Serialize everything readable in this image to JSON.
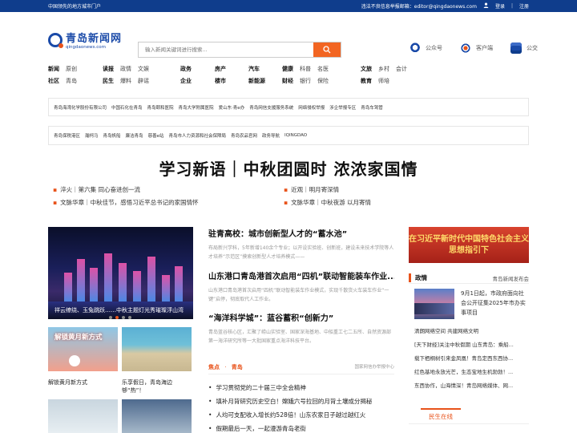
{
  "topbar": {
    "slogan": "中国领先的地方城市门户",
    "report_text": "违法不良信息举报邮箱：editor@qingdaonews.com",
    "login": "登录",
    "register": "注册"
  },
  "header": {
    "logo_cn": "青岛新闻网",
    "logo_en": "qingdaonews.com",
    "search_placeholder": "输入新闻关键词进行搜索...",
    "links": [
      {
        "label": "公众号",
        "icon": "wechat-icon"
      },
      {
        "label": "客户端",
        "icon": "app-icon"
      },
      {
        "label": "公交",
        "icon": "bus-icon"
      }
    ]
  },
  "nav": {
    "groups": [
      {
        "items": [
          "新闻",
          "原创",
          "社区",
          "青岛"
        ],
        "bold": [
          0,
          2
        ]
      },
      {
        "items": [
          "读报",
          "民生",
          "政情",
          "爆料",
          "文娱",
          "辟谣"
        ],
        "bold": [
          0,
          1
        ]
      },
      {
        "items": [
          "政务",
          "企业"
        ],
        "bold": [
          0,
          1
        ]
      },
      {
        "items": [
          "房产",
          "楼市"
        ],
        "bold": [
          0,
          1
        ]
      },
      {
        "items": [
          "汽车",
          "新能源"
        ],
        "bold": [
          0,
          1
        ]
      },
      {
        "items": [
          "健康",
          "财经",
          "科普",
          "银行",
          "名医",
          "保险"
        ],
        "bold": [
          0,
          1
        ]
      },
      {
        "items": [
          "文旅",
          "教育",
          "乡村",
          "师培",
          "会计"
        ],
        "bold": [
          0,
          1
        ]
      }
    ]
  },
  "linkbox1": [
    "青岛海湾化学股份有限公司",
    "中国石化在青岛",
    "青岛颐和医院",
    "青岛大学附属医院",
    "爱山东·青e办",
    "青岛网信支援服务系统",
    "网络侵权举报",
    "涉企举报专区",
    "青岛车驾管"
  ],
  "linkbox2": [
    "青岛保税港区",
    "瀚柯马",
    "青岛帆船",
    "廉洁青岛",
    "慈善e站",
    "青岛市人力资源和社会保障局",
    "青岛农品官网",
    "政务导航",
    "IQINGDAO"
  ],
  "headline": "学习新语｜中秋团圆时 浓浓家国情",
  "sublinks": [
    "淬火｜第六集 同心奋进创一流",
    "近观｜明月寄深情",
    "文脉华章｜中秋佳节，感悟习近平总书记的家国情怀",
    "文脉华章｜中秋夜游 以月寄情"
  ],
  "slider": {
    "caption": "祥云缭绕、玉兔跳跃……中秋主题灯光秀璀璨浮山湾"
  },
  "thumbs": [
    {
      "caption": "解锁黄月新方式",
      "overlay": "解锁黄月新方式"
    },
    {
      "caption": "乐享假日，青岛海边够“热”！"
    }
  ],
  "stories": [
    {
      "title": "驻青高校：城市创新型人才的“蓄水池”",
      "desc": "布局新兴学科，5年新增140余个专业；以开设实验班、创新班，建设未来技术学院等人才培养“示范区”摸索创新型人才培养模式——"
    },
    {
      "title": "山东港口青岛港首次启用“四机”联动智能装车作业...",
      "desc": "山东港口青岛港首次启用“四机”联动智能装车作业模式，实现千散货火车装车作业“一键”启停，彻底取代人工作业。"
    },
    {
      "title": "“海洋科学城”：蓝谷蓄积“创新力”",
      "desc": "青岛蓝谷核心区，汇聚了崂山实验室、国家深海基地、中船重工七二五所、自然资源部第一海洋研究所等一大批国家重点海洋科技平台。"
    }
  ],
  "focus": {
    "label": "焦点",
    "city": "青岛",
    "source": "国家网信办举报中心"
  },
  "bullets": [
    "学习贯彻党的二十届三中全会精神",
    "填补月背研究历史空白！嫦娥六号拉回的月背土壤成分揭秘",
    "人均可支配收入增长约528倍！山东农家日子越过越红火",
    "假期最后一天，一起漫游青岛老街"
  ],
  "right": {
    "banner": "在习近平新时代中国特色社会主义思想指引下",
    "section_title": "政情",
    "section_source": "青岛新闻发布会",
    "feature_text": "9月1日起，市政府面向社会公开征集2025年市办实事项目",
    "list": [
      "清朗网络空间 共建网络文明",
      "[天下财经]关注中秋假期 山东青岛：乘船...",
      "载下栖桐树引来金凤凰！青岛定西东西协...",
      "红色基地永放光芒，生态宝地生机勃勃！...",
      "东西协作，山海情深！青岛网络媒体、网..."
    ],
    "tab": "民生在线"
  },
  "colors": {
    "brand_blue": "#0f3d8c",
    "accent_orange": "#e8531b",
    "search_orange": "#f26522",
    "banner_red": "#c4342a"
  }
}
